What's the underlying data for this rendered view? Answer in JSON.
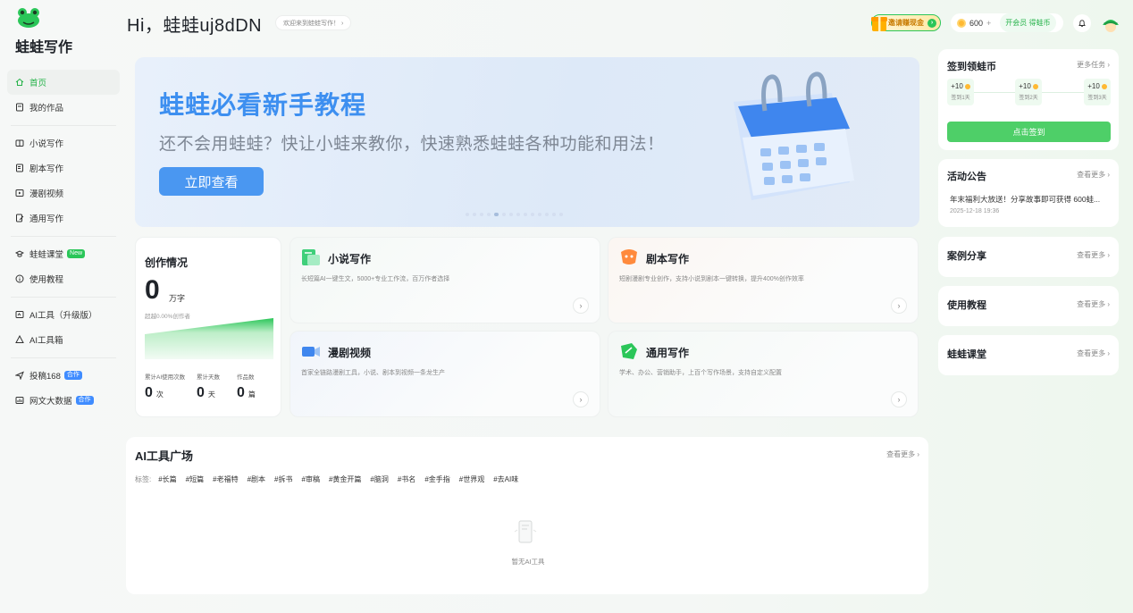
{
  "app": {
    "brand": "蛙蛙写作"
  },
  "sidebar": {
    "items": [
      {
        "label": "首页",
        "icon": "home-icon",
        "active": true
      },
      {
        "label": "我的作品",
        "icon": "works-icon"
      },
      {
        "label": "小说写作",
        "icon": "book-icon"
      },
      {
        "label": "剧本写作",
        "icon": "script-icon"
      },
      {
        "label": "漫剧视频",
        "icon": "video-icon"
      },
      {
        "label": "通用写作",
        "icon": "edit-icon"
      },
      {
        "label": "蛙蛙课堂",
        "icon": "graduation-icon",
        "badge": "New"
      },
      {
        "label": "使用教程",
        "icon": "info-icon"
      },
      {
        "label": "AI工具（升级版）",
        "icon": "ai-tool-icon"
      },
      {
        "label": "AI工具箱",
        "icon": "toolbox-icon"
      },
      {
        "label": "投稿168",
        "icon": "send-icon",
        "badge": "合作"
      },
      {
        "label": "网文大数据",
        "icon": "data-icon",
        "badge": "合作"
      }
    ]
  },
  "header": {
    "greeting": "Hi，蛙蛙uj8dDN",
    "welcome": "欢迎来到蛙蛙写作！ ›",
    "invite_label": "邀请赚现金",
    "coins": "600",
    "plus": "+",
    "vip_label": "开会员 得蛙币"
  },
  "banner": {
    "title": "蛙蛙必看新手教程",
    "subtitle": "还不会用蛙蛙？快让小蛙来教你，快速熟悉蛙蛙各种功能和用法！",
    "cta": "立即查看"
  },
  "checkin": {
    "title": "签到领蛙币",
    "more": "更多任务 ›",
    "days": [
      {
        "reward": "+10",
        "label": "签到1天"
      },
      {
        "reward": "+10",
        "label": "签到2天"
      },
      {
        "reward": "+10",
        "label": "签到3天"
      }
    ],
    "button": "点击签到"
  },
  "notice": {
    "title": "活动公告",
    "more": "查看更多 ›",
    "text": "年末福利大放送！分享故事即可获得 600蛙...",
    "date": "2025-12-18 19:36"
  },
  "cases": {
    "title": "案例分享",
    "more": "查看更多 ›"
  },
  "tutorials": {
    "title": "使用教程",
    "more": "查看更多 ›"
  },
  "classroom": {
    "title": "蛙蛙课堂",
    "more": "查看更多 ›"
  },
  "stats": {
    "title": "创作情况",
    "total": "0",
    "unit": "万字",
    "beat": "超越0.00%创作者",
    "cols": [
      {
        "label": "累计AI使用次数",
        "value": "0",
        "unit": "次"
      },
      {
        "label": "累计天数",
        "value": "0",
        "unit": "天"
      },
      {
        "label": "作品数",
        "value": "0",
        "unit": "篇"
      }
    ]
  },
  "features": [
    {
      "title": "小说写作",
      "desc": "长短篇AI一键生文，5000+专业工作流，百万作者选择",
      "icon": "novel-icon"
    },
    {
      "title": "剧本写作",
      "desc": "短剧漫剧专业创作，支持小说到剧本一键转换，提升400%创作效率",
      "icon": "script-card-icon"
    },
    {
      "title": "漫剧视频",
      "desc": "首家全链路漫剧工具，小说、剧本到视频一条龙生产",
      "icon": "video-card-icon"
    },
    {
      "title": "通用写作",
      "desc": "学术、办公、营销助手，上百个写作场景，支持自定义配置",
      "icon": "general-card-icon"
    }
  ],
  "ai_tools": {
    "title": "AI工具广场",
    "more": "查看更多 ›",
    "tags_label": "标签:",
    "tags": [
      "#长篇",
      "#短篇",
      "#老福特",
      "#剧本",
      "#拆书",
      "#审稿",
      "#黄金开篇",
      "#脑洞",
      "#书名",
      "#金手指",
      "#世界观",
      "#去AI味"
    ],
    "empty": "暂无AI工具"
  },
  "colors": {
    "accent": "#26b34a",
    "banner_title": "#3d8ff0",
    "button_blue": "#4a97f1",
    "checkin_green": "#4ecf68"
  }
}
